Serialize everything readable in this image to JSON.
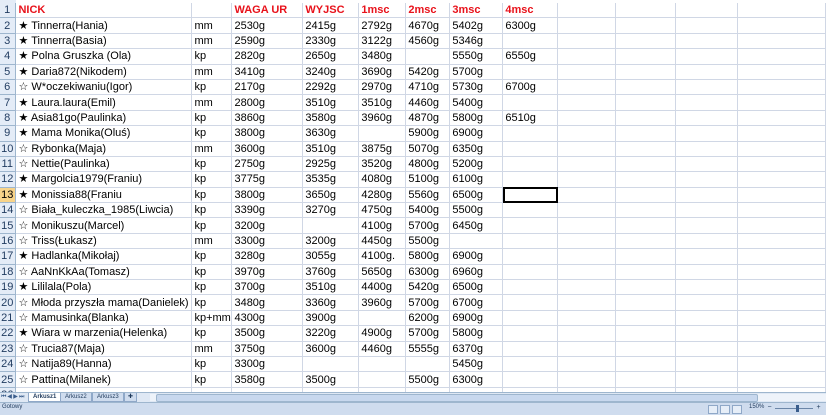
{
  "rows": [
    {
      "num": "1",
      "star": "",
      "cells": [
        "NICK",
        "",
        "WAGA UR",
        "WYJSC",
        "1msc",
        "2msc",
        "3msc",
        "4msc"
      ]
    },
    {
      "num": "2",
      "star": "★",
      "cells": [
        "Tinnerra(Hania)",
        "mm",
        "2530g",
        "2415g",
        "2792g",
        "4670g",
        "5402g",
        "6300g"
      ]
    },
    {
      "num": "3",
      "star": "★",
      "cells": [
        "Tinnerra(Basia)",
        "mm",
        "2590g",
        "2330g",
        "3122g",
        "4560g",
        "5346g",
        ""
      ]
    },
    {
      "num": "4",
      "star": "★",
      "cells": [
        "Polna Gruszka (Ola)",
        "kp",
        "2820g",
        "2650g",
        "3480g",
        "",
        "5550g",
        "6550g"
      ]
    },
    {
      "num": "5",
      "star": "★",
      "cells": [
        "Daria872(Nikodem)",
        "mm",
        "3410g",
        "3240g",
        "3690g",
        "5420g",
        "5700g",
        ""
      ]
    },
    {
      "num": "6",
      "star": "☆",
      "cells": [
        "W*oczekiwaniu(Igor)",
        "kp",
        "2170g",
        "2292g",
        "2970g",
        "4710g",
        "5730g",
        "6700g"
      ]
    },
    {
      "num": "7",
      "star": "★",
      "cells": [
        "Laura.laura(Emil)",
        "mm",
        "2800g",
        "3510g",
        "3510g",
        "4460g",
        "5400g",
        ""
      ]
    },
    {
      "num": "8",
      "star": "★",
      "cells": [
        "Asia81go(Paulinka)",
        "kp",
        "3860g",
        "3580g",
        "3960g",
        "4870g",
        "5800g",
        "6510g"
      ]
    },
    {
      "num": "9",
      "star": "★",
      "cells": [
        "Mama Monika(Oluś)",
        "kp",
        "3800g",
        "3630g",
        "",
        "5900g",
        "6900g",
        ""
      ]
    },
    {
      "num": "10",
      "star": "☆",
      "cells": [
        "Rybonka(Maja)",
        "mm",
        "3600g",
        "3510g",
        "3875g",
        "5070g",
        "6350g",
        ""
      ]
    },
    {
      "num": "11",
      "star": "☆",
      "cells": [
        "Nettie(Paulinka)",
        "kp",
        "2750g",
        "2925g",
        "3520g",
        "4800g",
        "5200g",
        ""
      ]
    },
    {
      "num": "12",
      "star": "★",
      "cells": [
        "Margolcia1979(Franiu)",
        "kp",
        "3775g",
        "3535g",
        "4080g",
        "5100g",
        "6100g",
        ""
      ]
    },
    {
      "num": "13",
      "star": "★",
      "cells": [
        "Monissia88(Franiu",
        "kp",
        "3800g",
        "3650g",
        "4280g",
        "5560g",
        "6500g",
        ""
      ]
    },
    {
      "num": "14",
      "star": "☆",
      "cells": [
        "Biała_kuleczka_1985(Liwcia)",
        "kp",
        "3390g",
        "3270g",
        "4750g",
        "5400g",
        "5500g",
        ""
      ]
    },
    {
      "num": "15",
      "star": "☆",
      "cells": [
        "Monikuszu(Marcel)",
        "kp",
        "3200g",
        "",
        "4100g",
        "5700g",
        "6450g",
        ""
      ]
    },
    {
      "num": "16",
      "star": "☆",
      "cells": [
        "Triss(Łukasz)",
        "mm",
        "3300g",
        "3200g",
        "4450g",
        "5500g",
        "",
        ""
      ]
    },
    {
      "num": "17",
      "star": "★",
      "cells": [
        "Hadlanka(Mikołaj)",
        "kp",
        "3280g",
        "3055g",
        "4100g.",
        "5800g",
        "6900g",
        ""
      ]
    },
    {
      "num": "18",
      "star": "☆",
      "cells": [
        "AaNnKkAa(Tomasz)",
        "kp",
        "3970g",
        "3760g",
        "5650g",
        "6300g",
        "6960g",
        ""
      ]
    },
    {
      "num": "19",
      "star": "★",
      "cells": [
        "Lililala(Pola)",
        "kp",
        "3700g",
        "3510g",
        "4400g",
        "5420g",
        "6500g",
        ""
      ]
    },
    {
      "num": "20",
      "star": "☆",
      "cells": [
        "Młoda przyszła mama(Danielek)",
        "kp",
        "3480g",
        "3360g",
        "3960g",
        "5700g",
        "6700g",
        ""
      ]
    },
    {
      "num": "21",
      "star": "☆",
      "cells": [
        "Mamusinka(Blanka)",
        "kp+mm",
        "4300g",
        "3900g",
        "",
        "6200g",
        "6900g",
        ""
      ]
    },
    {
      "num": "22",
      "star": "★",
      "cells": [
        "Wiara w marzenia(Helenka)",
        "kp",
        "3500g",
        "3220g",
        "4900g",
        "5700g",
        "5800g",
        ""
      ]
    },
    {
      "num": "23",
      "star": "☆",
      "cells": [
        "Trucia87(Maja)",
        "mm",
        "3750g",
        "3600g",
        "4460g",
        "5555g",
        "6370g",
        ""
      ]
    },
    {
      "num": "24",
      "star": "☆",
      "cells": [
        "Natija89(Hanna)",
        "kp",
        "3300g",
        "",
        "",
        "",
        "5450g",
        ""
      ]
    },
    {
      "num": "25",
      "star": "☆",
      "cells": [
        "Pattina(Milanek)",
        "kp",
        "3580g",
        "3500g",
        "",
        "5500g",
        "6300g",
        ""
      ]
    },
    {
      "num": "26",
      "star": "",
      "cells": [
        "",
        "",
        "",
        "",
        "",
        "",
        "",
        ""
      ]
    },
    {
      "num": "27",
      "star": "",
      "cells": [
        "",
        "",
        "",
        "",
        "",
        "",
        "",
        ""
      ]
    }
  ],
  "sheet_tabs": [
    "Arkusz1",
    "Arkusz2",
    "Arkusz3"
  ],
  "active_tab": "Arkusz1",
  "status": {
    "text": "Gotowy",
    "zoom": "150%"
  },
  "colors": {
    "header_text": "#e8121b",
    "row_header_bg": "#e4ecf7",
    "selected_row_header": "#f8d48a",
    "gridline": "#d0d7e5"
  }
}
